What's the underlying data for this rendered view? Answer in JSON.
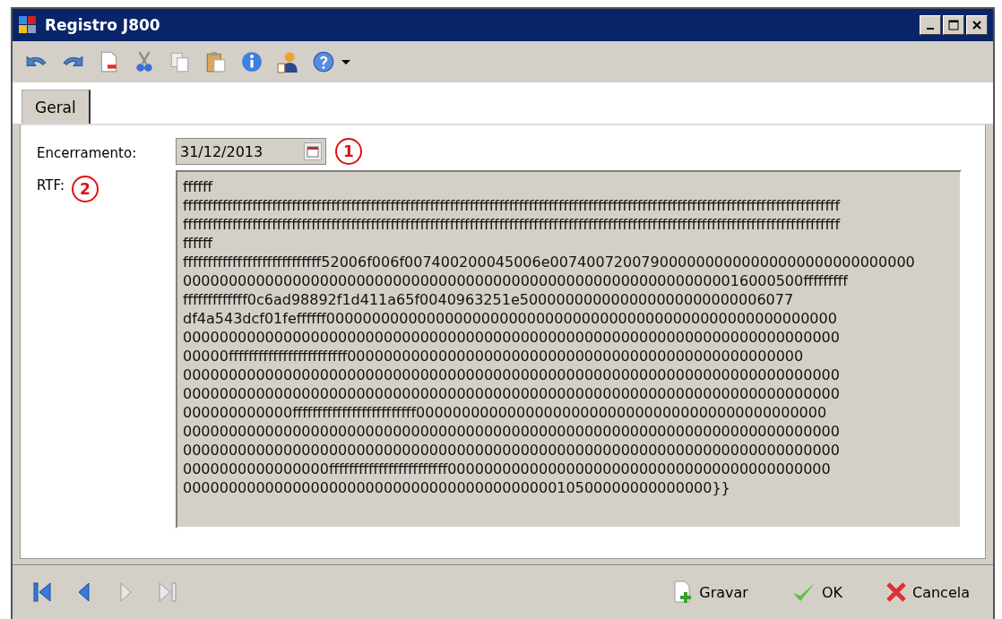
{
  "window": {
    "title": "Registro J800"
  },
  "toolbar": [
    {
      "kind": "undo"
    },
    {
      "kind": "redo"
    },
    {
      "kind": "new"
    },
    {
      "kind": "cut"
    },
    {
      "kind": "copy"
    },
    {
      "kind": "paste"
    },
    {
      "kind": "info"
    },
    {
      "kind": "user"
    },
    {
      "kind": "help"
    },
    {
      "kind": "dropdown"
    }
  ],
  "tabs": [
    {
      "label": "Geral",
      "selected": true
    }
  ],
  "form": {
    "encerramento": {
      "label": "Encerramento:",
      "value": "31/12/2013",
      "marker": "1"
    },
    "rtf": {
      "label": "RTF:",
      "marker": "2",
      "lines": [
        "ffffff",
        "fffffffffffffffffffffffffffffffffffffffffffffffffffffffffffffffffffffffffffffffffffffffffffffffffffffffffffffffffffffffffffffffffffff",
        "fffffffffffffffffffffffffffffffffffffffffffffffffffffffffffffffffffffffffffffffffffffffffffffffffffffffffffffffffffffffffffffffffffff",
        "ffffff",
        "ffffffffffffffffffffffffffff52006f006f007400200045006e0074007200790000000000000000000000000000",
        "00000000000000000000000000000000000000000000000000000000000016000500fffffffff",
        "fffffffffffff0c6ad98892f1d411a65f0040963251e500000000000000000000000006077",
        "df4a543dcf01feffffff00000000000000000000000000000000000000000000000000000000",
        "000000000000000000000000000000000000000000000000000000000000000000000000",
        "00000ffffffffffffffffffffffff00000000000000000000000000000000000000000000000000",
        "000000000000000000000000000000000000000000000000000000000000000000000000",
        "000000000000000000000000000000000000000000000000000000000000000000000000",
        "000000000000fffffffffffffffffffffffff000000000000000000000000000000000000000000000",
        "000000000000000000000000000000000000000000000000000000000000000000000000",
        "000000000000000000000000000000000000000000000000000000000000000000000000",
        "0000000000000000ffffffffffffffffffffffff000000000000000000000000000000000000000000",
        "0000000000000000000000000000000000000000010500000000000000}}"
      ]
    }
  },
  "navigation": [
    {
      "kind": "first",
      "disabled": false
    },
    {
      "kind": "previous",
      "disabled": false
    },
    {
      "kind": "next",
      "disabled": true
    },
    {
      "kind": "last",
      "disabled": true
    }
  ],
  "buttons": [
    {
      "kind": "save",
      "label": "Gravar"
    },
    {
      "kind": "ok",
      "label": "OK"
    },
    {
      "kind": "cancel",
      "label": "Cancela"
    }
  ]
}
